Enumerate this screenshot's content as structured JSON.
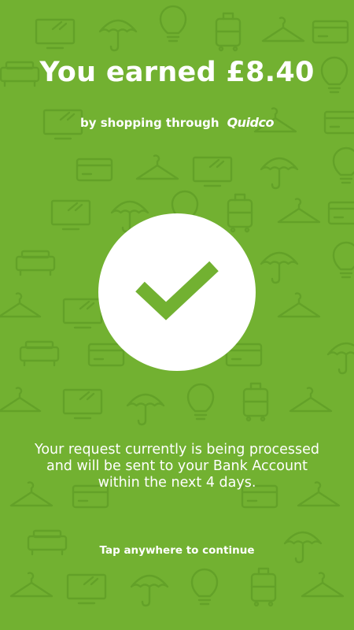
{
  "earned": {
    "headline": "You earned £8.40"
  },
  "source": {
    "prefix": "by shopping through",
    "brand": "Quidco"
  },
  "status": {
    "icon": "checkmark-icon",
    "lines": [
      "Your request currently is being processed",
      "and will be sent to your Bank Account",
      "within the next 4 days."
    ]
  },
  "continue_hint": "Tap anywhere to continue",
  "colors": {
    "background": "#72b131",
    "pattern": "#63a128",
    "circle": "#ffffff",
    "check": "#72b131"
  },
  "background_pattern_icons": [
    "tv-icon",
    "umbrella-icon",
    "lightbulb-icon",
    "suitcase-icon",
    "hanger-icon",
    "sofa-icon",
    "credit-card-icon"
  ]
}
